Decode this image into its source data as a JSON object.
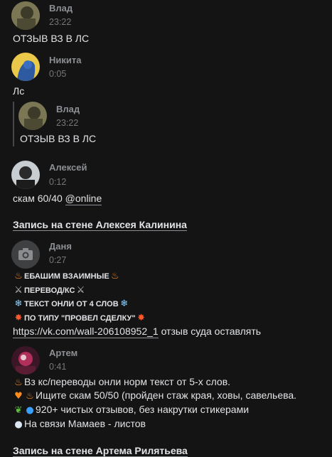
{
  "messages": [
    {
      "name": "Влад",
      "time": "23:22",
      "text": "ОТЗЫВ ВЗ В ЛС"
    },
    {
      "name": "Никита",
      "time": "0:05",
      "text": "Лс",
      "quote": {
        "name": "Влад",
        "time": "23:22",
        "text": "ОТЗЫВ ВЗ В ЛС"
      }
    },
    {
      "name": "Алексей",
      "time": "0:12",
      "text": "скам 60/40",
      "mention": "@online",
      "wall_post": "Запись на стене Алексея Калинина"
    },
    {
      "name": "Даня",
      "time": "0:27",
      "lines": [
        "ЕБАШИМ ВЗАИМНЫЕ",
        "ПЕРЕВОД/КС",
        "ТЕКСТ ОНЛИ ОТ 4 СЛОВ",
        "ПО ТИПУ \"ПРОВЕЛ СДЕЛКУ\""
      ],
      "link": "https://vk.com/wall-206108952_1",
      "link_tail": " отзыв суда оставлять"
    },
    {
      "name": "Артем",
      "time": "0:41",
      "lines": [
        "Вз кс/переводы онли норм текст от 5-х слов.",
        "Ищите скам 50/50 (пройден стаж края, ховы, савельева.",
        "920+ чистых отзывов, без накрутки стикерами",
        "На связи Мамаев - листов"
      ],
      "wall_post": "Запись на стене Артема Рилятьева"
    }
  ],
  "icons": {
    "fire": "fire-icon",
    "sword": "crossed-swords-icon",
    "snow": "snowflake-icon",
    "boom": "explosion-icon",
    "heart": "orange-heart-icon",
    "leaf": "leaf-icon",
    "drop": "droplet-icon",
    "chat": "speech-bubble-icon",
    "camera": "camera-icon"
  }
}
